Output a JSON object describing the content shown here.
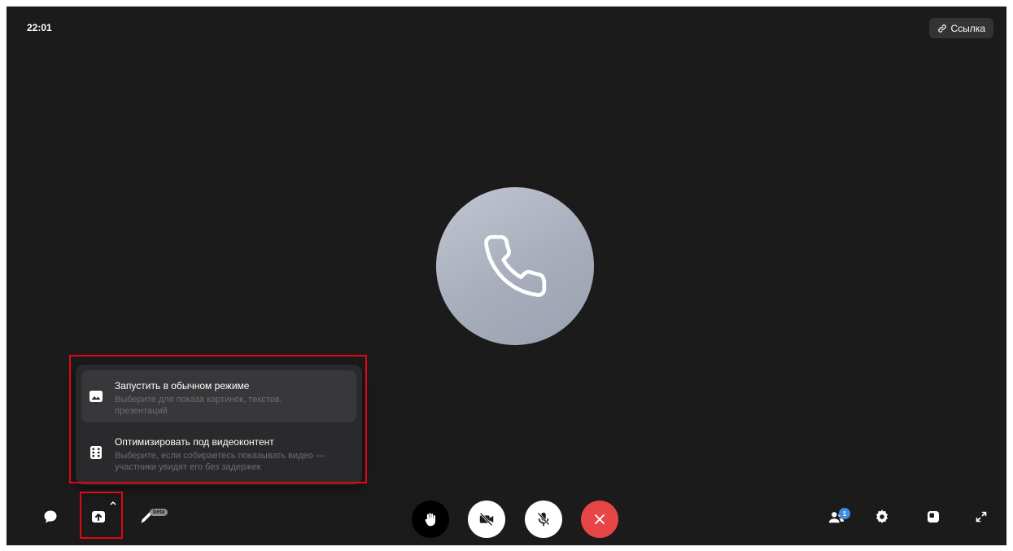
{
  "header": {
    "time": "22:01",
    "link_label": "Ссылка"
  },
  "share_menu": {
    "items": [
      {
        "title": "Запустить в обычном режиме",
        "desc_line1": "Выберите для показа картинок, текстов,",
        "desc_line2": "презентаций",
        "icon": "image-icon"
      },
      {
        "title": "Оптимизировать под видеоконтент",
        "desc_line1": "Выберите, если собираетесь показывать видео —",
        "desc_line2": "участники увидят его без задержек",
        "icon": "film-icon"
      }
    ]
  },
  "controls": {
    "left": [
      "chat-icon",
      "screen-share-icon",
      "pen-icon"
    ],
    "beta_label": "beta",
    "center": [
      "raise-hand-icon",
      "camera-off-icon",
      "mic-off-icon",
      "end-call-icon"
    ],
    "right": [
      "participants-icon",
      "settings-icon",
      "layout-icon",
      "fullscreen-icon"
    ],
    "participants_count": "1"
  },
  "colors": {
    "background": "#1b1b1c",
    "end_call": "#e64646",
    "highlight": "#e30613",
    "badge": "#3d8fe0"
  }
}
